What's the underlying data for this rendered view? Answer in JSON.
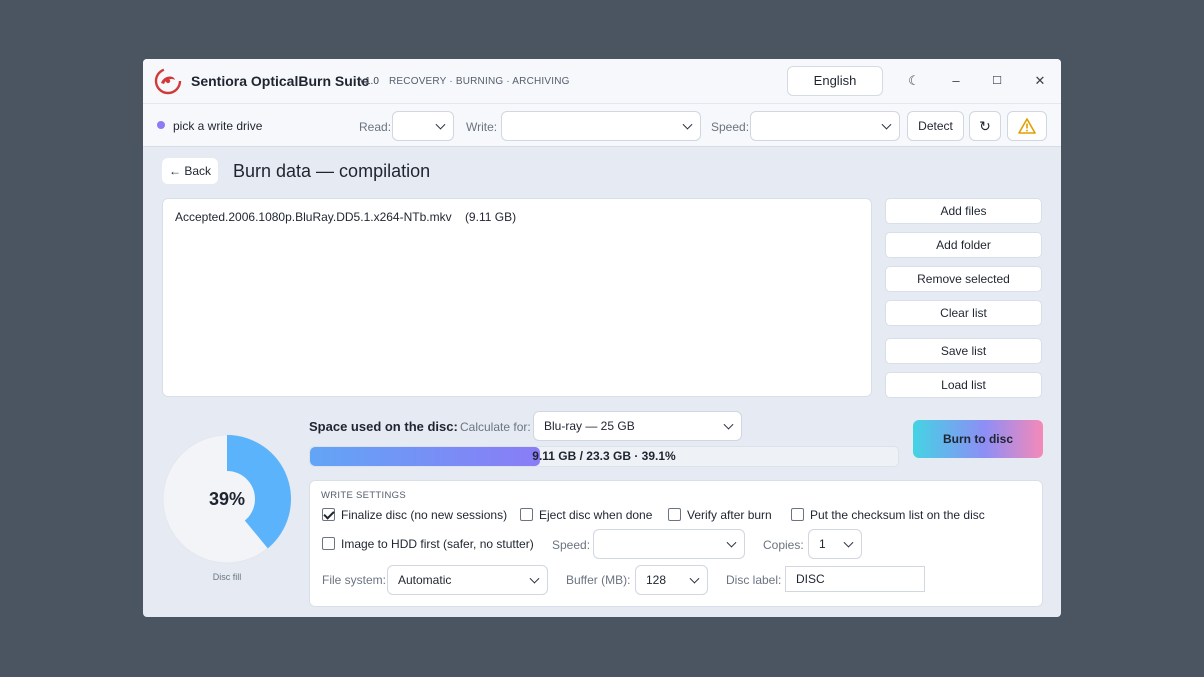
{
  "app": {
    "title": "Sentiora OpticalBurn Suite",
    "version": "v1.0",
    "tagline": "RECOVERY · BURNING · ARCHIVING",
    "language": "English"
  },
  "window_controls": {
    "theme": "☾",
    "minimize": "–",
    "maximize": "☐",
    "close": "✕"
  },
  "toolbar": {
    "status": "pick a write drive",
    "status_color": "#8b7cf6",
    "read_label": "Read:",
    "read_value": "",
    "write_label": "Write:",
    "write_value": "",
    "speed_label": "Speed:",
    "speed_value": "",
    "detect_label": "Detect",
    "refresh_icon": "↻"
  },
  "page": {
    "back_label": "← Back",
    "title": "Burn data — compilation"
  },
  "files": [
    {
      "name": "Accepted.2006.1080p.BluRay.DD5.1.x264-NTb.mkv",
      "size": "(9.11 GB)"
    }
  ],
  "side_buttons": [
    "Add files",
    "Add folder",
    "Remove selected",
    "Clear list",
    "Save list",
    "Load list"
  ],
  "disc": {
    "fill_percent": 39,
    "fill_label": "39%",
    "caption": "Disc fill",
    "space_label": "Space used on the disc:",
    "calc_label": "Calculate for:",
    "calc_value": "Blu-ray — 25 GB",
    "progress_fraction": 0.391,
    "progress_text": "9.11 GB / 23.3 GB  ·  39.1%"
  },
  "burn_label": "Burn to disc",
  "settings": {
    "header": "WRITE SETTINGS",
    "finalize": "Finalize disc (no new sessions)",
    "eject": "Eject disc when done",
    "verify": "Verify after burn",
    "checksum": "Put the checksum list on the disc",
    "image_hdd": "Image to HDD first (safer, no stutter)",
    "speed_label": "Speed:",
    "speed_value": "",
    "copies_label": "Copies:",
    "copies_value": "1",
    "fs_label": "File system:",
    "fs_value": "Automatic",
    "buffer_label": "Buffer (MB):",
    "buffer_value": "128",
    "label_label": "Disc label:",
    "label_value": "DISC"
  },
  "colors": {
    "accent_start": "#62a5f6",
    "accent_end": "#8a7cf6",
    "donut_fill": "#5bb4fb",
    "donut_track": "#eef1f6"
  }
}
